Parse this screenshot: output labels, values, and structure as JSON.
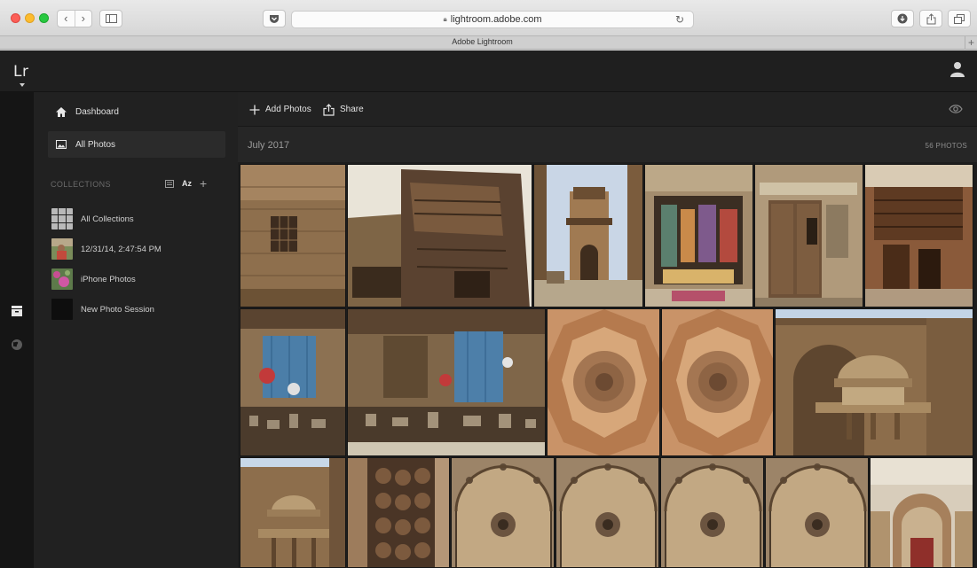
{
  "browser": {
    "url": "lightroom.adobe.com",
    "tab_title": "Adobe Lightroom",
    "back_glyph": "‹",
    "forward_glyph": "›",
    "reload_glyph": "↻",
    "new_tab_glyph": "+"
  },
  "app": {
    "logo": "Lr"
  },
  "sidebar": {
    "nav": [
      {
        "label": "Dashboard",
        "icon": "home-icon"
      },
      {
        "label": "All Photos",
        "icon": "photos-icon",
        "active": true
      }
    ],
    "collections_header": "COLLECTIONS",
    "sort_label": "Az",
    "add_glyph": "+",
    "collections": [
      {
        "label": "All Collections",
        "thumb": "grid"
      },
      {
        "label": "12/31/14, 2:47:54 PM",
        "thumb": "portrait"
      },
      {
        "label": "iPhone Photos",
        "thumb": "flowers"
      },
      {
        "label": "New Photo Session",
        "thumb": "empty"
      }
    ]
  },
  "toolbar": {
    "add_photos_label": "Add Photos",
    "share_label": "Share"
  },
  "section": {
    "date": "July 2017",
    "count": "56 PHOTOS"
  },
  "colors": {
    "app_bg": "#1c1c1c",
    "sidebar_bg": "#212121",
    "rail_bg": "#151515",
    "text": "#e0e0e0"
  },
  "photos": [
    {
      "subject": "Stone wall with mashrabiya window"
    },
    {
      "subject": "Wooden mashrabiya balconies"
    },
    {
      "subject": "Minaret over narrow street"
    },
    {
      "subject": "Shop with colorful wares"
    },
    {
      "subject": "Arched wooden doorway with sign"
    },
    {
      "subject": "Ornate wooden facade"
    },
    {
      "subject": "Shop with blue shutters"
    },
    {
      "subject": "Street shops with goods"
    },
    {
      "subject": "Dome ceiling interior"
    },
    {
      "subject": "Dome ceiling interior"
    },
    {
      "subject": "Domed fountain courtyard"
    },
    {
      "subject": "Domed kiosk"
    },
    {
      "subject": "Brass lanterns"
    },
    {
      "subject": "Ornate metal grille"
    },
    {
      "subject": "Ornate metal grille"
    },
    {
      "subject": "Ornate metal grille"
    },
    {
      "subject": "Ornate metal grille"
    },
    {
      "subject": "Decorated stone facade"
    }
  ]
}
